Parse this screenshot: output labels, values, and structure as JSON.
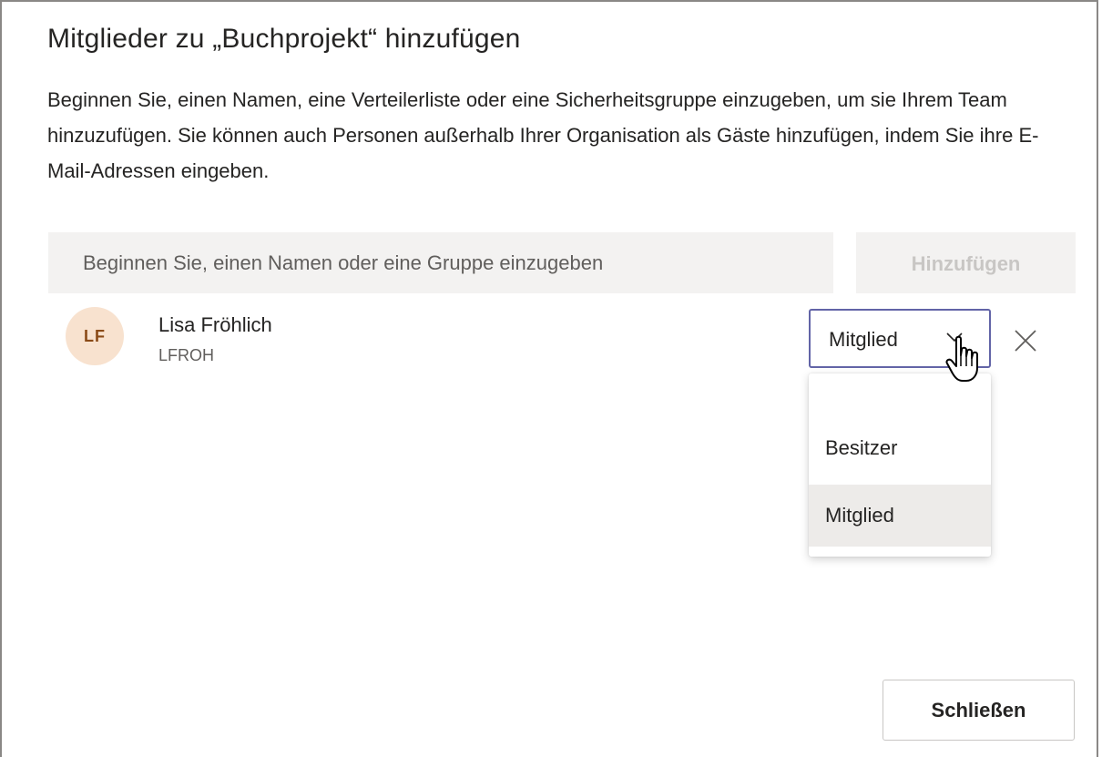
{
  "dialog": {
    "title": "Mitglieder zu „Buchprojekt“ hinzufügen",
    "description": "Beginnen Sie, einen Namen, eine Verteilerliste oder eine Sicherheitsgruppe einzugeben, um sie Ihrem Team hinzuzufügen. Sie können auch Personen außerhalb Ihrer Organisation als Gäste hinzufügen, indem Sie ihre E-Mail-Adressen eingeben."
  },
  "search": {
    "placeholder": "Beginnen Sie, einen Namen oder eine Gruppe einzugeben",
    "value": ""
  },
  "add_button": {
    "label": "Hinzufügen",
    "enabled": false
  },
  "member": {
    "initials": "LF",
    "name": "Lisa Fröhlich",
    "id": "LFROH",
    "role": "Mitglied",
    "remove_icon": "close-icon"
  },
  "role_dropdown": {
    "options": [
      "Besitzer",
      "Mitglied"
    ],
    "highlighted": "Mitglied"
  },
  "footer": {
    "close_label": "Schließen"
  },
  "colors": {
    "accent": "#6264a7",
    "avatar_bg": "#f8e2cf",
    "avatar_text": "#8a4a17",
    "input_bg": "#f3f2f1",
    "highlight_bg": "#edebe9"
  }
}
